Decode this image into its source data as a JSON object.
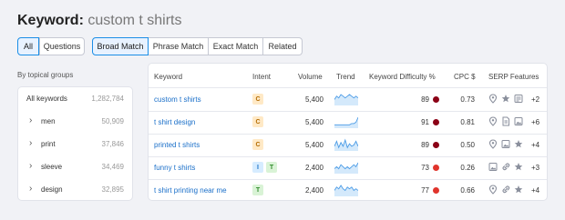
{
  "header": {
    "label": "Keyword:",
    "keyword": "custom t shirts"
  },
  "filters": {
    "type_tabs": [
      "All",
      "Questions"
    ],
    "match_tabs": [
      "Broad Match",
      "Phrase Match",
      "Exact Match",
      "Related"
    ],
    "active_type": "All",
    "active_match": "Broad Match"
  },
  "sidebar": {
    "heading": "By topical groups",
    "groups": [
      {
        "label": "All keywords",
        "count": "1,282,784"
      },
      {
        "label": "men",
        "count": "50,909"
      },
      {
        "label": "print",
        "count": "37,846"
      },
      {
        "label": "sleeve",
        "count": "34,469"
      },
      {
        "label": "design",
        "count": "32,895"
      }
    ]
  },
  "table": {
    "columns": [
      "Keyword",
      "Intent",
      "Volume",
      "Trend",
      "Keyword Difficulty %",
      "CPC $",
      "SERP Features"
    ],
    "rows": [
      {
        "keyword": "custom t shirts",
        "intent": [
          "C"
        ],
        "volume": "5,400",
        "kd": "89",
        "kd_color": "#8b0016",
        "cpc": "0.73",
        "serp_icons": [
          "location-icon",
          "star-icon",
          "reviews-icon"
        ],
        "serp_more": "+2",
        "trend": [
          3,
          5,
          4,
          6,
          5,
          4,
          5,
          6,
          5,
          4,
          5,
          4
        ]
      },
      {
        "keyword": "t shirt design",
        "intent": [
          "C"
        ],
        "volume": "5,400",
        "kd": "91",
        "kd_color": "#8b0016",
        "cpc": "0.81",
        "serp_icons": [
          "location-icon",
          "document-icon",
          "image-icon"
        ],
        "serp_more": "+6",
        "trend": [
          2,
          2,
          2,
          2,
          2,
          2,
          2,
          2,
          3,
          3,
          4,
          8
        ]
      },
      {
        "keyword": "printed t shirts",
        "intent": [
          "C"
        ],
        "volume": "5,400",
        "kd": "89",
        "kd_color": "#8b0016",
        "cpc": "0.50",
        "serp_icons": [
          "location-icon",
          "image-icon",
          "star-icon"
        ],
        "serp_more": "+4",
        "trend": [
          3,
          7,
          2,
          6,
          3,
          8,
          2,
          5,
          3,
          4,
          7,
          3
        ]
      },
      {
        "keyword": "funny t shirts",
        "intent": [
          "I",
          "T"
        ],
        "volume": "2,400",
        "kd": "73",
        "kd_color": "#e0342c",
        "cpc": "0.26",
        "serp_icons": [
          "image-icon",
          "link-icon",
          "star-icon"
        ],
        "serp_more": "+3",
        "trend": [
          2,
          3,
          2,
          4,
          3,
          2,
          3,
          2,
          3,
          4,
          3,
          5
        ]
      },
      {
        "keyword": "t shirt printing near me",
        "intent": [
          "T"
        ],
        "volume": "2,400",
        "kd": "77",
        "kd_color": "#e0342c",
        "cpc": "0.66",
        "serp_icons": [
          "location-icon",
          "link-icon",
          "star-icon"
        ],
        "serp_more": "+4",
        "trend": [
          3,
          5,
          4,
          6,
          4,
          3,
          5,
          4,
          5,
          3,
          4,
          3
        ]
      }
    ]
  }
}
